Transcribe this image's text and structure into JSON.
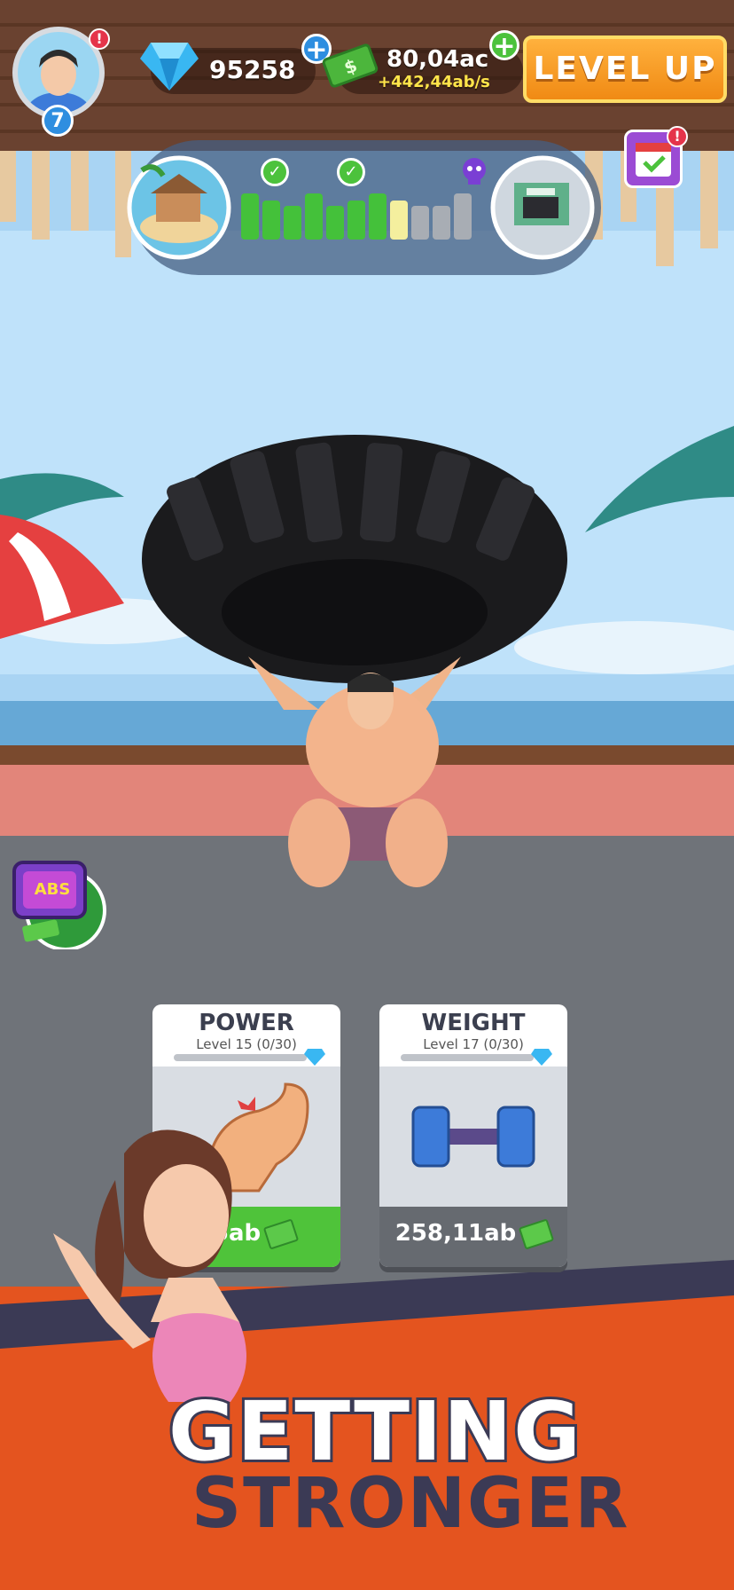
{
  "header": {
    "player_level": "7",
    "avatar_alert": "!",
    "gems": "95258",
    "cash": "80,04ac",
    "cash_rate": "+442,44ab/s",
    "level_up_label": "LEVEL UP",
    "calendar_alert": "!"
  },
  "progress": {
    "segments": [
      "green",
      "green",
      "green",
      "green",
      "green",
      "green",
      "green",
      "yellow",
      "gray",
      "gray",
      "gray"
    ]
  },
  "cards": [
    {
      "title": "POWER",
      "level": "Level 15 (0/30)",
      "price": "55ab",
      "footer_color": "#4fc33a"
    },
    {
      "title": "WEIGHT",
      "level": "Level 17 (0/30)",
      "price": "258,11ab",
      "footer_color": "#666a70"
    }
  ],
  "tv_label": "ABS",
  "banner": {
    "line1": "GETTING",
    "line2": "STRONGER"
  },
  "colors": {
    "accent_orange": "#f08a14",
    "gem_blue": "#39b7f2",
    "green": "#4cc23c"
  }
}
